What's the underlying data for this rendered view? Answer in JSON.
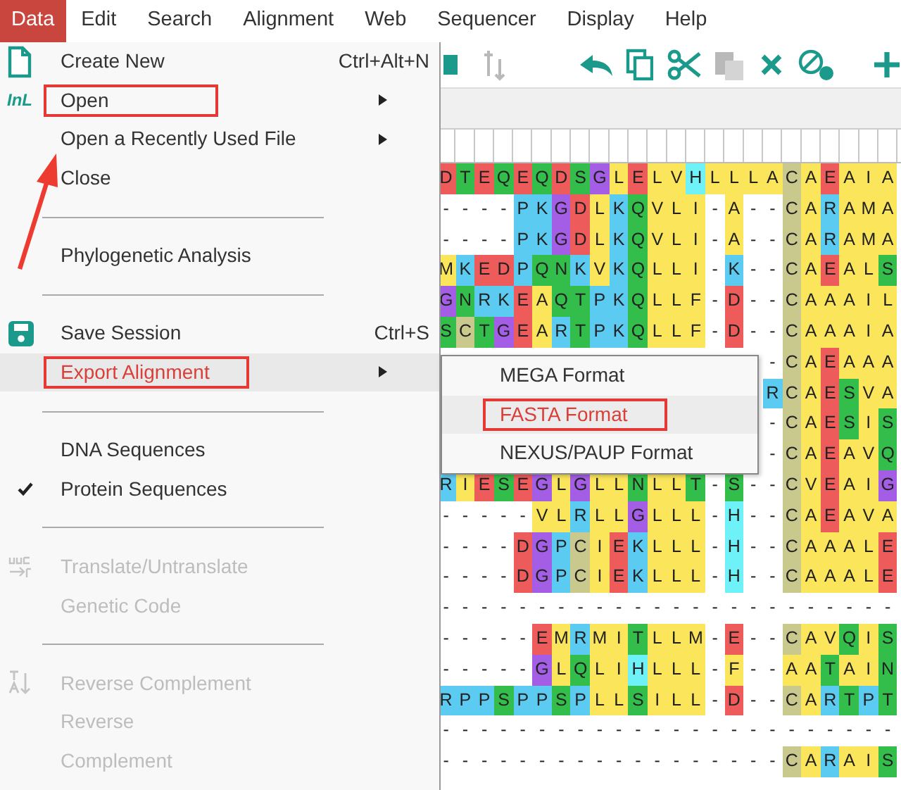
{
  "menubar": [
    {
      "label": "Data",
      "selected": true
    },
    {
      "label": "Edit",
      "selected": false
    },
    {
      "label": "Search",
      "selected": false
    },
    {
      "label": "Alignment",
      "selected": false
    },
    {
      "label": "Web",
      "selected": false
    },
    {
      "label": "Sequencer",
      "selected": false
    },
    {
      "label": "Display",
      "selected": false
    },
    {
      "label": "Help",
      "selected": false
    }
  ],
  "data_menu": {
    "items": [
      {
        "kind": "item",
        "label": "Create New",
        "shortcut": "Ctrl+Alt+N",
        "submenu": false,
        "disabled": false,
        "selected": false,
        "annotated": false
      },
      {
        "kind": "item",
        "icon_text": "InL",
        "label": "Open",
        "submenu": true,
        "disabled": false,
        "selected": false,
        "annotated": true
      },
      {
        "kind": "item",
        "label": "Open a Recently Used File",
        "submenu": true,
        "disabled": false,
        "selected": false,
        "annotated": false
      },
      {
        "kind": "item",
        "label": "Close",
        "submenu": false,
        "disabled": false,
        "selected": false,
        "annotated": false
      },
      {
        "kind": "separator"
      },
      {
        "kind": "item",
        "label": "Phylogenetic Analysis",
        "submenu": false,
        "disabled": false,
        "selected": false,
        "annotated": false
      },
      {
        "kind": "separator"
      },
      {
        "kind": "item",
        "label": "Save Session",
        "shortcut": "Ctrl+S",
        "submenu": false,
        "disabled": false,
        "selected": false,
        "annotated": false
      },
      {
        "kind": "item",
        "label": "Export Alignment",
        "submenu": true,
        "disabled": false,
        "selected": true,
        "annotated": true
      },
      {
        "kind": "separator"
      },
      {
        "kind": "item",
        "label": "DNA Sequences",
        "submenu": false,
        "checked": false,
        "disabled": false,
        "selected": false,
        "annotated": false
      },
      {
        "kind": "item",
        "label": "Protein Sequences",
        "submenu": false,
        "checked": true,
        "disabled": false,
        "selected": false,
        "annotated": false
      },
      {
        "kind": "separator"
      },
      {
        "kind": "item",
        "label": "Translate/Untranslate",
        "submenu": false,
        "disabled": true,
        "selected": false,
        "annotated": false
      },
      {
        "kind": "item",
        "label": "Genetic Code",
        "submenu": false,
        "disabled": true,
        "selected": false,
        "annotated": false
      },
      {
        "kind": "separator"
      },
      {
        "kind": "item",
        "label": "Reverse Complement",
        "submenu": false,
        "disabled": true,
        "selected": false,
        "annotated": false
      },
      {
        "kind": "item",
        "label": "Reverse",
        "submenu": false,
        "disabled": true,
        "selected": false,
        "annotated": false
      },
      {
        "kind": "item",
        "label": "Complement",
        "submenu": false,
        "disabled": true,
        "selected": false,
        "annotated": false
      }
    ]
  },
  "export_submenu": {
    "items": [
      {
        "label": "MEGA Format",
        "selected": false,
        "annotated": false
      },
      {
        "label": "FASTA Format",
        "selected": true,
        "annotated": true
      },
      {
        "label": "NEXUS/PAUP Format",
        "selected": false,
        "annotated": false
      }
    ]
  },
  "alignment": {
    "rows": [
      [
        {
          "aa": "D",
          "color": "#ee5b5b"
        },
        {
          "aa": "T",
          "color": "#33bd4a"
        },
        {
          "aa": "E",
          "color": "#ee5b5b"
        },
        {
          "aa": "Q",
          "color": "#33bd4a"
        },
        {
          "aa": "E",
          "color": "#ee5b5b"
        },
        {
          "aa": "Q",
          "color": "#33bd4a"
        },
        {
          "aa": "D",
          "color": "#ee5b5b"
        },
        {
          "aa": "S",
          "color": "#33bd4a"
        },
        {
          "aa": "G",
          "color": "#a45ee6"
        },
        {
          "aa": "L",
          "color": "#fbe55a"
        },
        {
          "aa": "E",
          "color": "#ee5b5b"
        },
        {
          "aa": "L",
          "color": "#fbe55a"
        },
        {
          "aa": "V",
          "color": "#fbe55a"
        },
        {
          "aa": "H",
          "color": "#6ef2f7"
        },
        {
          "aa": "L",
          "color": "#fbe55a"
        },
        {
          "aa": "L",
          "color": "#fbe55a"
        },
        {
          "aa": "L",
          "color": "#fbe55a"
        },
        {
          "aa": "A",
          "color": "#fbe55a"
        },
        {
          "aa": "C",
          "color": "#c9c98e"
        },
        {
          "aa": "A",
          "color": "#fbe55a"
        },
        {
          "aa": "E",
          "color": "#ee5b5b"
        },
        {
          "aa": "A",
          "color": "#fbe55a"
        },
        {
          "aa": "I",
          "color": "#fbe55a"
        },
        {
          "aa": "A",
          "color": "#fbe55a"
        }
      ],
      [
        {
          "aa": "-"
        },
        {
          "aa": "-"
        },
        {
          "aa": "-"
        },
        {
          "aa": "-"
        },
        {
          "aa": "P",
          "color": "#5ccbf2"
        },
        {
          "aa": "K",
          "color": "#5ccbf2"
        },
        {
          "aa": "G",
          "color": "#a45ee6"
        },
        {
          "aa": "D",
          "color": "#ee5b5b"
        },
        {
          "aa": "L",
          "color": "#fbe55a"
        },
        {
          "aa": "K",
          "color": "#5ccbf2"
        },
        {
          "aa": "Q",
          "color": "#33bd4a"
        },
        {
          "aa": "V",
          "color": "#fbe55a"
        },
        {
          "aa": "L",
          "color": "#fbe55a"
        },
        {
          "aa": "I",
          "color": "#fbe55a"
        },
        {
          "aa": "-"
        },
        {
          "aa": "A",
          "color": "#fbe55a"
        },
        {
          "aa": "-"
        },
        {
          "aa": "-"
        },
        {
          "aa": "C",
          "color": "#c9c98e"
        },
        {
          "aa": "A",
          "color": "#fbe55a"
        },
        {
          "aa": "R",
          "color": "#5ccbf2"
        },
        {
          "aa": "A",
          "color": "#fbe55a"
        },
        {
          "aa": "M",
          "color": "#fbe55a"
        },
        {
          "aa": "A",
          "color": "#fbe55a"
        }
      ],
      [
        {
          "aa": "-"
        },
        {
          "aa": "-"
        },
        {
          "aa": "-"
        },
        {
          "aa": "-"
        },
        {
          "aa": "P",
          "color": "#5ccbf2"
        },
        {
          "aa": "K",
          "color": "#5ccbf2"
        },
        {
          "aa": "G",
          "color": "#a45ee6"
        },
        {
          "aa": "D",
          "color": "#ee5b5b"
        },
        {
          "aa": "L",
          "color": "#fbe55a"
        },
        {
          "aa": "K",
          "color": "#5ccbf2"
        },
        {
          "aa": "Q",
          "color": "#33bd4a"
        },
        {
          "aa": "V",
          "color": "#fbe55a"
        },
        {
          "aa": "L",
          "color": "#fbe55a"
        },
        {
          "aa": "I",
          "color": "#fbe55a"
        },
        {
          "aa": "-"
        },
        {
          "aa": "A",
          "color": "#fbe55a"
        },
        {
          "aa": "-"
        },
        {
          "aa": "-"
        },
        {
          "aa": "C",
          "color": "#c9c98e"
        },
        {
          "aa": "A",
          "color": "#fbe55a"
        },
        {
          "aa": "R",
          "color": "#5ccbf2"
        },
        {
          "aa": "A",
          "color": "#fbe55a"
        },
        {
          "aa": "M",
          "color": "#fbe55a"
        },
        {
          "aa": "A",
          "color": "#fbe55a"
        }
      ],
      [
        {
          "aa": "M",
          "color": "#fbe55a"
        },
        {
          "aa": "K",
          "color": "#5ccbf2"
        },
        {
          "aa": "E",
          "color": "#ee5b5b"
        },
        {
          "aa": "D",
          "color": "#ee5b5b"
        },
        {
          "aa": "P",
          "color": "#5ccbf2"
        },
        {
          "aa": "Q",
          "color": "#33bd4a"
        },
        {
          "aa": "N",
          "color": "#33bd4a"
        },
        {
          "aa": "K",
          "color": "#5ccbf2"
        },
        {
          "aa": "V",
          "color": "#fbe55a"
        },
        {
          "aa": "K",
          "color": "#5ccbf2"
        },
        {
          "aa": "Q",
          "color": "#33bd4a"
        },
        {
          "aa": "L",
          "color": "#fbe55a"
        },
        {
          "aa": "L",
          "color": "#fbe55a"
        },
        {
          "aa": "I",
          "color": "#fbe55a"
        },
        {
          "aa": "-"
        },
        {
          "aa": "K",
          "color": "#5ccbf2"
        },
        {
          "aa": "-"
        },
        {
          "aa": "-"
        },
        {
          "aa": "C",
          "color": "#c9c98e"
        },
        {
          "aa": "A",
          "color": "#fbe55a"
        },
        {
          "aa": "E",
          "color": "#ee5b5b"
        },
        {
          "aa": "A",
          "color": "#fbe55a"
        },
        {
          "aa": "L",
          "color": "#fbe55a"
        },
        {
          "aa": "S",
          "color": "#33bd4a"
        }
      ],
      [
        {
          "aa": "G",
          "color": "#a45ee6"
        },
        {
          "aa": "N",
          "color": "#33bd4a"
        },
        {
          "aa": "R",
          "color": "#5ccbf2"
        },
        {
          "aa": "K",
          "color": "#5ccbf2"
        },
        {
          "aa": "E",
          "color": "#ee5b5b"
        },
        {
          "aa": "A",
          "color": "#fbe55a"
        },
        {
          "aa": "Q",
          "color": "#33bd4a"
        },
        {
          "aa": "T",
          "color": "#33bd4a"
        },
        {
          "aa": "P",
          "color": "#5ccbf2"
        },
        {
          "aa": "K",
          "color": "#5ccbf2"
        },
        {
          "aa": "Q",
          "color": "#33bd4a"
        },
        {
          "aa": "L",
          "color": "#fbe55a"
        },
        {
          "aa": "L",
          "color": "#fbe55a"
        },
        {
          "aa": "F",
          "color": "#fbe55a"
        },
        {
          "aa": "-"
        },
        {
          "aa": "D",
          "color": "#ee5b5b"
        },
        {
          "aa": "-"
        },
        {
          "aa": "-"
        },
        {
          "aa": "C",
          "color": "#c9c98e"
        },
        {
          "aa": "A",
          "color": "#fbe55a"
        },
        {
          "aa": "A",
          "color": "#fbe55a"
        },
        {
          "aa": "A",
          "color": "#fbe55a"
        },
        {
          "aa": "I",
          "color": "#fbe55a"
        },
        {
          "aa": "L",
          "color": "#fbe55a"
        }
      ],
      [
        {
          "aa": "S",
          "color": "#33bd4a"
        },
        {
          "aa": "C",
          "color": "#c9c98e"
        },
        {
          "aa": "T",
          "color": "#33bd4a"
        },
        {
          "aa": "G",
          "color": "#a45ee6"
        },
        {
          "aa": "E",
          "color": "#ee5b5b"
        },
        {
          "aa": "A",
          "color": "#fbe55a"
        },
        {
          "aa": "R",
          "color": "#5ccbf2"
        },
        {
          "aa": "T",
          "color": "#33bd4a"
        },
        {
          "aa": "P",
          "color": "#5ccbf2"
        },
        {
          "aa": "K",
          "color": "#5ccbf2"
        },
        {
          "aa": "Q",
          "color": "#33bd4a"
        },
        {
          "aa": "L",
          "color": "#fbe55a"
        },
        {
          "aa": "L",
          "color": "#fbe55a"
        },
        {
          "aa": "F",
          "color": "#fbe55a"
        },
        {
          "aa": "-"
        },
        {
          "aa": "D",
          "color": "#ee5b5b"
        },
        {
          "aa": "-"
        },
        {
          "aa": "-"
        },
        {
          "aa": "C",
          "color": "#c9c98e"
        },
        {
          "aa": "A",
          "color": "#fbe55a"
        },
        {
          "aa": "A",
          "color": "#fbe55a"
        },
        {
          "aa": "A",
          "color": "#fbe55a"
        },
        {
          "aa": "I",
          "color": "#fbe55a"
        },
        {
          "aa": "A",
          "color": "#fbe55a"
        }
      ],
      [
        {
          "aa": "-"
        },
        {
          "aa": "C",
          "color": "#c9c98e"
        },
        {
          "aa": "A",
          "color": "#fbe55a"
        },
        {
          "aa": "E",
          "color": "#ee5b5b"
        },
        {
          "aa": "A",
          "color": "#fbe55a"
        },
        {
          "aa": "A",
          "color": "#fbe55a"
        },
        {
          "aa": "A",
          "color": "#fbe55a"
        }
      ],
      [
        {
          "aa": "R",
          "color": "#5ccbf2"
        },
        {
          "aa": "C",
          "color": "#c9c98e"
        },
        {
          "aa": "A",
          "color": "#fbe55a"
        },
        {
          "aa": "E",
          "color": "#ee5b5b"
        },
        {
          "aa": "S",
          "color": "#33bd4a"
        },
        {
          "aa": "V",
          "color": "#fbe55a"
        },
        {
          "aa": "A",
          "color": "#fbe55a"
        }
      ],
      [
        {
          "aa": "-"
        },
        {
          "aa": "C",
          "color": "#c9c98e"
        },
        {
          "aa": "A",
          "color": "#fbe55a"
        },
        {
          "aa": "E",
          "color": "#ee5b5b"
        },
        {
          "aa": "S",
          "color": "#33bd4a"
        },
        {
          "aa": "I",
          "color": "#fbe55a"
        },
        {
          "aa": "S",
          "color": "#33bd4a"
        }
      ],
      [
        {
          "aa": "-"
        },
        {
          "aa": "C",
          "color": "#c9c98e"
        },
        {
          "aa": "A",
          "color": "#fbe55a"
        },
        {
          "aa": "E",
          "color": "#ee5b5b"
        },
        {
          "aa": "A",
          "color": "#fbe55a"
        },
        {
          "aa": "V",
          "color": "#fbe55a"
        },
        {
          "aa": "Q",
          "color": "#33bd4a"
        }
      ],
      [
        {
          "aa": "R",
          "color": "#5ccbf2"
        },
        {
          "aa": "I",
          "color": "#fbe55a"
        },
        {
          "aa": "E",
          "color": "#ee5b5b"
        },
        {
          "aa": "S",
          "color": "#33bd4a"
        },
        {
          "aa": "E",
          "color": "#ee5b5b"
        },
        {
          "aa": "G",
          "color": "#a45ee6"
        },
        {
          "aa": "L",
          "color": "#fbe55a"
        },
        {
          "aa": "G",
          "color": "#a45ee6"
        },
        {
          "aa": "L",
          "color": "#fbe55a"
        },
        {
          "aa": "L",
          "color": "#fbe55a"
        },
        {
          "aa": "N",
          "color": "#33bd4a"
        },
        {
          "aa": "L",
          "color": "#fbe55a"
        },
        {
          "aa": "L",
          "color": "#fbe55a"
        },
        {
          "aa": "T",
          "color": "#33bd4a"
        },
        {
          "aa": "-"
        },
        {
          "aa": "S",
          "color": "#33bd4a"
        },
        {
          "aa": "-"
        },
        {
          "aa": "-"
        },
        {
          "aa": "C",
          "color": "#c9c98e"
        },
        {
          "aa": "V",
          "color": "#fbe55a"
        },
        {
          "aa": "E",
          "color": "#ee5b5b"
        },
        {
          "aa": "A",
          "color": "#fbe55a"
        },
        {
          "aa": "I",
          "color": "#fbe55a"
        },
        {
          "aa": "G",
          "color": "#a45ee6"
        }
      ],
      [
        {
          "aa": "-"
        },
        {
          "aa": "-"
        },
        {
          "aa": "-"
        },
        {
          "aa": "-"
        },
        {
          "aa": "-"
        },
        {
          "aa": "V",
          "color": "#fbe55a"
        },
        {
          "aa": "L",
          "color": "#fbe55a"
        },
        {
          "aa": "R",
          "color": "#5ccbf2"
        },
        {
          "aa": "L",
          "color": "#fbe55a"
        },
        {
          "aa": "L",
          "color": "#fbe55a"
        },
        {
          "aa": "G",
          "color": "#a45ee6"
        },
        {
          "aa": "L",
          "color": "#fbe55a"
        },
        {
          "aa": "L",
          "color": "#fbe55a"
        },
        {
          "aa": "L",
          "color": "#fbe55a"
        },
        {
          "aa": "-"
        },
        {
          "aa": "H",
          "color": "#6ef2f7"
        },
        {
          "aa": "-"
        },
        {
          "aa": "-"
        },
        {
          "aa": "C",
          "color": "#c9c98e"
        },
        {
          "aa": "A",
          "color": "#fbe55a"
        },
        {
          "aa": "E",
          "color": "#ee5b5b"
        },
        {
          "aa": "A",
          "color": "#fbe55a"
        },
        {
          "aa": "V",
          "color": "#fbe55a"
        },
        {
          "aa": "A",
          "color": "#fbe55a"
        }
      ],
      [
        {
          "aa": "-"
        },
        {
          "aa": "-"
        },
        {
          "aa": "-"
        },
        {
          "aa": "-"
        },
        {
          "aa": "D",
          "color": "#ee5b5b"
        },
        {
          "aa": "G",
          "color": "#a45ee6"
        },
        {
          "aa": "P",
          "color": "#5ccbf2"
        },
        {
          "aa": "C",
          "color": "#c9c98e"
        },
        {
          "aa": "I",
          "color": "#fbe55a"
        },
        {
          "aa": "E",
          "color": "#ee5b5b"
        },
        {
          "aa": "K",
          "color": "#5ccbf2"
        },
        {
          "aa": "L",
          "color": "#fbe55a"
        },
        {
          "aa": "L",
          "color": "#fbe55a"
        },
        {
          "aa": "L",
          "color": "#fbe55a"
        },
        {
          "aa": "-"
        },
        {
          "aa": "H",
          "color": "#6ef2f7"
        },
        {
          "aa": "-"
        },
        {
          "aa": "-"
        },
        {
          "aa": "C",
          "color": "#c9c98e"
        },
        {
          "aa": "A",
          "color": "#fbe55a"
        },
        {
          "aa": "A",
          "color": "#fbe55a"
        },
        {
          "aa": "A",
          "color": "#fbe55a"
        },
        {
          "aa": "L",
          "color": "#fbe55a"
        },
        {
          "aa": "E",
          "color": "#ee5b5b"
        }
      ],
      [
        {
          "aa": "-"
        },
        {
          "aa": "-"
        },
        {
          "aa": "-"
        },
        {
          "aa": "-"
        },
        {
          "aa": "D",
          "color": "#ee5b5b"
        },
        {
          "aa": "G",
          "color": "#a45ee6"
        },
        {
          "aa": "P",
          "color": "#5ccbf2"
        },
        {
          "aa": "C",
          "color": "#c9c98e"
        },
        {
          "aa": "I",
          "color": "#fbe55a"
        },
        {
          "aa": "E",
          "color": "#ee5b5b"
        },
        {
          "aa": "K",
          "color": "#5ccbf2"
        },
        {
          "aa": "L",
          "color": "#fbe55a"
        },
        {
          "aa": "L",
          "color": "#fbe55a"
        },
        {
          "aa": "L",
          "color": "#fbe55a"
        },
        {
          "aa": "-"
        },
        {
          "aa": "H",
          "color": "#6ef2f7"
        },
        {
          "aa": "-"
        },
        {
          "aa": "-"
        },
        {
          "aa": "C",
          "color": "#c9c98e"
        },
        {
          "aa": "A",
          "color": "#fbe55a"
        },
        {
          "aa": "A",
          "color": "#fbe55a"
        },
        {
          "aa": "A",
          "color": "#fbe55a"
        },
        {
          "aa": "L",
          "color": "#fbe55a"
        },
        {
          "aa": "E",
          "color": "#ee5b5b"
        }
      ],
      [
        {
          "aa": "-"
        },
        {
          "aa": "-"
        },
        {
          "aa": "-"
        },
        {
          "aa": "-"
        },
        {
          "aa": "-"
        },
        {
          "aa": "-"
        },
        {
          "aa": "-"
        },
        {
          "aa": "-"
        },
        {
          "aa": "-"
        },
        {
          "aa": "-"
        },
        {
          "aa": "-"
        },
        {
          "aa": "-"
        },
        {
          "aa": "-"
        },
        {
          "aa": "-"
        },
        {
          "aa": "-"
        },
        {
          "aa": "-"
        },
        {
          "aa": "-"
        },
        {
          "aa": "-"
        },
        {
          "aa": "-"
        },
        {
          "aa": "-"
        },
        {
          "aa": "-"
        },
        {
          "aa": "-"
        },
        {
          "aa": "-"
        },
        {
          "aa": "-"
        }
      ],
      [
        {
          "aa": "-"
        },
        {
          "aa": "-"
        },
        {
          "aa": "-"
        },
        {
          "aa": "-"
        },
        {
          "aa": "-"
        },
        {
          "aa": "E",
          "color": "#ee5b5b"
        },
        {
          "aa": "M",
          "color": "#fbe55a"
        },
        {
          "aa": "R",
          "color": "#5ccbf2"
        },
        {
          "aa": "M",
          "color": "#fbe55a"
        },
        {
          "aa": "I",
          "color": "#fbe55a"
        },
        {
          "aa": "T",
          "color": "#33bd4a"
        },
        {
          "aa": "L",
          "color": "#fbe55a"
        },
        {
          "aa": "L",
          "color": "#fbe55a"
        },
        {
          "aa": "M",
          "color": "#fbe55a"
        },
        {
          "aa": "-"
        },
        {
          "aa": "E",
          "color": "#ee5b5b"
        },
        {
          "aa": "-"
        },
        {
          "aa": "-"
        },
        {
          "aa": "C",
          "color": "#c9c98e"
        },
        {
          "aa": "A",
          "color": "#fbe55a"
        },
        {
          "aa": "V",
          "color": "#fbe55a"
        },
        {
          "aa": "Q",
          "color": "#33bd4a"
        },
        {
          "aa": "I",
          "color": "#fbe55a"
        },
        {
          "aa": "S",
          "color": "#33bd4a"
        }
      ],
      [
        {
          "aa": "-"
        },
        {
          "aa": "-"
        },
        {
          "aa": "-"
        },
        {
          "aa": "-"
        },
        {
          "aa": "-"
        },
        {
          "aa": "G",
          "color": "#a45ee6"
        },
        {
          "aa": "L",
          "color": "#fbe55a"
        },
        {
          "aa": "Q",
          "color": "#33bd4a"
        },
        {
          "aa": "L",
          "color": "#fbe55a"
        },
        {
          "aa": "I",
          "color": "#fbe55a"
        },
        {
          "aa": "H",
          "color": "#6ef2f7"
        },
        {
          "aa": "L",
          "color": "#fbe55a"
        },
        {
          "aa": "L",
          "color": "#fbe55a"
        },
        {
          "aa": "L",
          "color": "#fbe55a"
        },
        {
          "aa": "-"
        },
        {
          "aa": "F",
          "color": "#fbe55a"
        },
        {
          "aa": "-"
        },
        {
          "aa": "-"
        },
        {
          "aa": "A",
          "color": "#fbe55a"
        },
        {
          "aa": "A",
          "color": "#fbe55a"
        },
        {
          "aa": "T",
          "color": "#33bd4a"
        },
        {
          "aa": "A",
          "color": "#fbe55a"
        },
        {
          "aa": "I",
          "color": "#fbe55a"
        },
        {
          "aa": "N",
          "color": "#33bd4a"
        }
      ],
      [
        {
          "aa": "R",
          "color": "#5ccbf2"
        },
        {
          "aa": "P",
          "color": "#5ccbf2"
        },
        {
          "aa": "P",
          "color": "#5ccbf2"
        },
        {
          "aa": "S",
          "color": "#33bd4a"
        },
        {
          "aa": "P",
          "color": "#5ccbf2"
        },
        {
          "aa": "P",
          "color": "#5ccbf2"
        },
        {
          "aa": "S",
          "color": "#33bd4a"
        },
        {
          "aa": "P",
          "color": "#5ccbf2"
        },
        {
          "aa": "L",
          "color": "#fbe55a"
        },
        {
          "aa": "L",
          "color": "#fbe55a"
        },
        {
          "aa": "S",
          "color": "#33bd4a"
        },
        {
          "aa": "I",
          "color": "#fbe55a"
        },
        {
          "aa": "L",
          "color": "#fbe55a"
        },
        {
          "aa": "L",
          "color": "#fbe55a"
        },
        {
          "aa": "-"
        },
        {
          "aa": "D",
          "color": "#ee5b5b"
        },
        {
          "aa": "-"
        },
        {
          "aa": "-"
        },
        {
          "aa": "C",
          "color": "#c9c98e"
        },
        {
          "aa": "A",
          "color": "#fbe55a"
        },
        {
          "aa": "R",
          "color": "#5ccbf2"
        },
        {
          "aa": "T",
          "color": "#33bd4a"
        },
        {
          "aa": "P",
          "color": "#5ccbf2"
        },
        {
          "aa": "T",
          "color": "#33bd4a"
        }
      ],
      [
        {
          "aa": "-"
        },
        {
          "aa": "-"
        },
        {
          "aa": "-"
        },
        {
          "aa": "-"
        },
        {
          "aa": "-"
        },
        {
          "aa": "-"
        },
        {
          "aa": "-"
        },
        {
          "aa": "-"
        },
        {
          "aa": "-"
        },
        {
          "aa": "-"
        },
        {
          "aa": "-"
        },
        {
          "aa": "-"
        },
        {
          "aa": "-"
        },
        {
          "aa": "-"
        },
        {
          "aa": "-"
        },
        {
          "aa": "-"
        },
        {
          "aa": "-"
        },
        {
          "aa": "-"
        },
        {
          "aa": "-"
        },
        {
          "aa": "-"
        },
        {
          "aa": "-"
        },
        {
          "aa": "-"
        },
        {
          "aa": "-"
        },
        {
          "aa": "-"
        }
      ],
      [
        {
          "aa": "-"
        },
        {
          "aa": "-"
        },
        {
          "aa": "-"
        },
        {
          "aa": "-"
        },
        {
          "aa": "-"
        },
        {
          "aa": "-"
        },
        {
          "aa": "-"
        },
        {
          "aa": "-"
        },
        {
          "aa": "-"
        },
        {
          "aa": "-"
        },
        {
          "aa": "-"
        },
        {
          "aa": "-"
        },
        {
          "aa": "-"
        },
        {
          "aa": "-"
        },
        {
          "aa": "-"
        },
        {
          "aa": "-"
        },
        {
          "aa": "-"
        },
        {
          "aa": "-"
        },
        {
          "aa": "C",
          "color": "#c9c98e"
        },
        {
          "aa": "A",
          "color": "#fbe55a"
        },
        {
          "aa": "R",
          "color": "#5ccbf2"
        },
        {
          "aa": "A",
          "color": "#fbe55a"
        },
        {
          "aa": "I",
          "color": "#fbe55a"
        },
        {
          "aa": "S",
          "color": "#33bd4a"
        }
      ]
    ]
  }
}
